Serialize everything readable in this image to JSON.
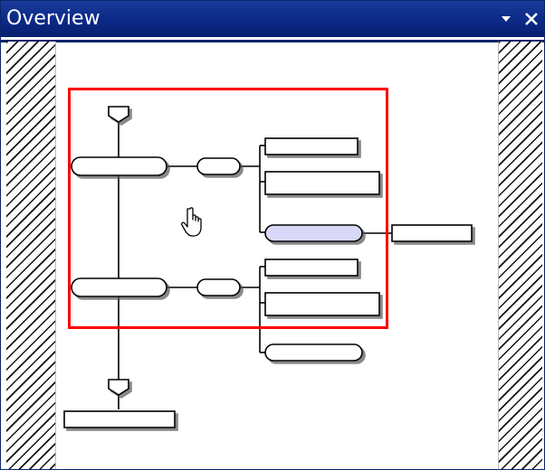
{
  "window": {
    "title": "Overview",
    "dropdown_icon": "chevron-down-icon",
    "close_icon": "close-icon"
  },
  "colors": {
    "title_bar": "#0b2a86",
    "viewport_frame": "#ff0000",
    "highlighted_node": "#d8d8f8"
  },
  "cursor": "hand-cursor-icon"
}
